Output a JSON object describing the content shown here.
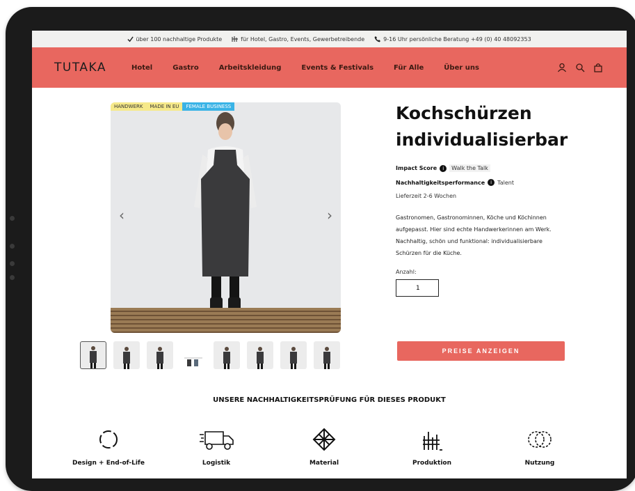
{
  "topbar": {
    "items": [
      "über 100 nachhaltige Produkte",
      "für Hotel, Gastro, Events, Gewerbetreibende",
      "9-16 Uhr persönliche Beratung +49 (0) 40 48092353"
    ],
    "icons": [
      "check-icon",
      "hotel-icon",
      "phone-icon"
    ]
  },
  "nav": {
    "logo": "TUTAKA",
    "items": [
      "Hotel",
      "Gastro",
      "Arbeitskleidung",
      "Events & Festivals",
      "Für Alle",
      "Über uns"
    ],
    "icons": [
      "user-icon",
      "search-icon",
      "bag-icon"
    ]
  },
  "product": {
    "badges": [
      "HANDWERK",
      "MADE IN EU",
      "FEMALE BUSINESS"
    ],
    "badge_colors": [
      "#f6e98a",
      "#f6e98a",
      "#3ab3e6"
    ],
    "title_line1": "Kochschürzen",
    "title_line2": "individualisierbar",
    "impact_label": "Impact Score",
    "impact_value": "Walk the Talk",
    "performance_label": "Nachhaltigkeitsperformance",
    "performance_value": "Talent",
    "delivery": "Lieferzeit 2-6 Wochen",
    "description": "Gastronomen, Gastronominnen, Köche und Köchinnen aufgepasst. Hier sind echte Handwerkerinnen am Werk. Nachhaltig, schön und funktional: individualisierbare Schürzen für die Küche.",
    "quantity_label": "Anzahl:",
    "quantity_value": "1",
    "price_button": "PREISE ANZEIGEN",
    "thumbnail_count": 8
  },
  "sustainability": {
    "heading": "UNSERE NACHHALTIGKEITSPRÜFUNG FÜR DIESES PRODUKT",
    "features": [
      {
        "label": "Design + End-of-Life",
        "icon": "recycle-icon"
      },
      {
        "label": "Logistik",
        "icon": "truck-icon"
      },
      {
        "label": "Material",
        "icon": "fabric-icon"
      },
      {
        "label": "Produktion",
        "icon": "factory-icon"
      },
      {
        "label": "Nutzung",
        "icon": "rings-icon"
      }
    ]
  },
  "colors": {
    "accent": "#e8675f",
    "topbar_bg": "#f1f1ef",
    "frame": "#1b1b1b"
  }
}
